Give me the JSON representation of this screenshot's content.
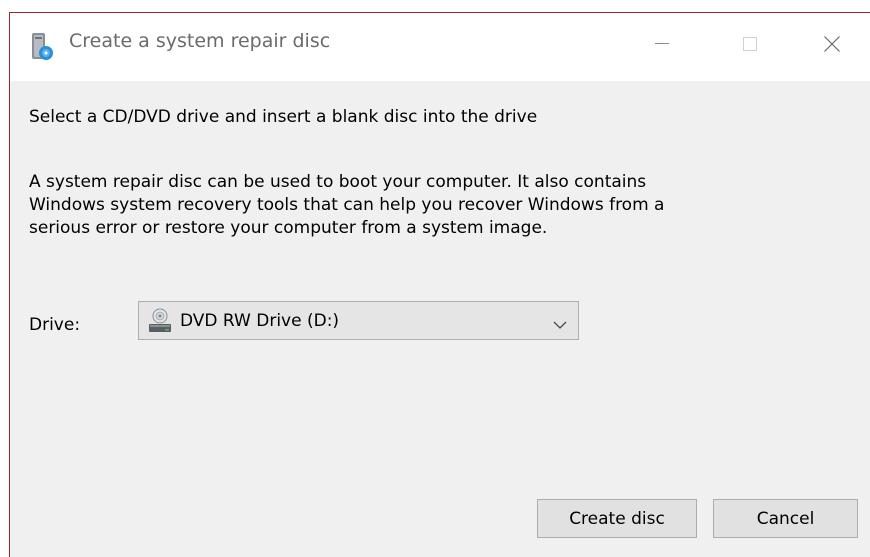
{
  "window": {
    "title": "Create a system repair disc",
    "title_color": "#6b6b6b",
    "accent_border": "#a4262c",
    "icon": "repair-disc-app-icon"
  },
  "caption_buttons": {
    "minimize_icon": "minimize-icon",
    "maximize_icon": "maximize-icon",
    "close_icon": "close-icon"
  },
  "content": {
    "heading": "Select a CD/DVD drive and insert a blank disc into the drive",
    "description_lines": [
      "A system repair disc can be used to boot your computer. It also contains",
      "Windows system recovery tools that can help you recover Windows from a",
      "serious error or restore your computer from a system image."
    ]
  },
  "drive": {
    "label": "Drive:",
    "selected": "DVD RW Drive (D:)",
    "icon": "dvd-drive-icon"
  },
  "buttons": {
    "create": "Create disc",
    "cancel": "Cancel"
  }
}
